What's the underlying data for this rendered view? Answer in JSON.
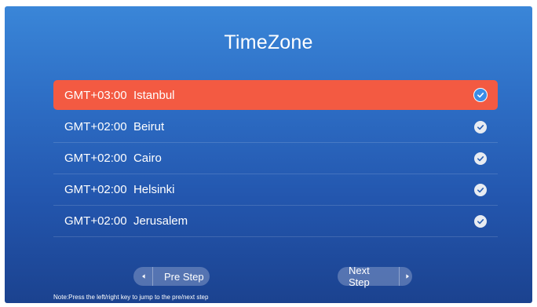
{
  "screen": {
    "title": "TimeZone"
  },
  "timezones": [
    {
      "offset": "GMT+03:00",
      "city": "Istanbul",
      "label": "GMT+03:00  Istanbul",
      "selected": true
    },
    {
      "offset": "GMT+02:00",
      "city": "Beirut",
      "label": "GMT+02:00  Beirut",
      "selected": false
    },
    {
      "offset": "GMT+02:00",
      "city": "Cairo",
      "label": "GMT+02:00  Cairo",
      "selected": false
    },
    {
      "offset": "GMT+02:00",
      "city": "Helsinki",
      "label": "GMT+02:00  Helsinki",
      "selected": false
    },
    {
      "offset": "GMT+02:00",
      "city": "Jerusalem",
      "label": "GMT+02:00  Jerusalem",
      "selected": false
    }
  ],
  "navigation": {
    "pre_step_label": "Pre Step",
    "next_step_label": "Next Step",
    "pre_icon": "arrow-left-icon",
    "next_icon": "arrow-right-icon"
  },
  "footer": {
    "note": "Note:Press the left/right key to jump to the pre/next step"
  },
  "icons": {
    "check": "check-circle-icon"
  },
  "colors": {
    "selected_row": "#f35a42",
    "selected_check": "#3b8de6",
    "background_top": "#3a86d8",
    "background_bottom": "#1b428f"
  }
}
